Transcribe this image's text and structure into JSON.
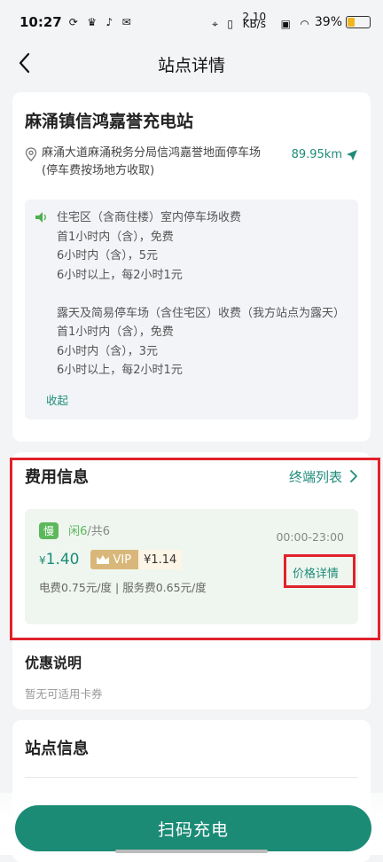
{
  "status_bar": {
    "time": "10:27",
    "net_speed_value": "2.10",
    "net_speed_unit": "KB/s",
    "battery": "39%",
    "battery_level": 0.39
  },
  "nav": {
    "title": "站点详情"
  },
  "station": {
    "name": "麻涌镇信鸿嘉誉充电站",
    "address": "麻涌大道麻涌税务分局信鸿嘉誉地面停车场",
    "parking_note": "(停车费按场地方收取)",
    "distance": "89.95km",
    "notice": "住宅区（含商住楼）室内停车场收费\n首1小时内（含），免费\n6小时内（含），5元\n6小时以上，每2小时1元\n\n露天及简易停车场（含住宅区）收费（我方站点为露天）\n首1小时内（含），免费\n6小时内（含），3元\n6小时以上，每2小时1元",
    "collapse_label": "收起"
  },
  "fee": {
    "title": "费用信息",
    "terminal_link": "终端列表",
    "slow_badge": "慢",
    "idle": "闲6",
    "total": "/共6",
    "hours": "00:00-23:00",
    "currency": "¥",
    "price": "1.40",
    "vip_label": "VIP",
    "vip_price": "¥1.14",
    "price_detail": "价格详情",
    "breakdown": "电费0.75元/度 | 服务费0.65元/度",
    "discount_title": "优惠说明",
    "discount_text": "暂无可适用卡券"
  },
  "info": {
    "title": "站点信息"
  },
  "action": {
    "scan_label": "扫码充电"
  },
  "colors": {
    "accent": "#1b8b76",
    "highlight": "#e0212b",
    "vip_gold": "#d9b77a"
  }
}
